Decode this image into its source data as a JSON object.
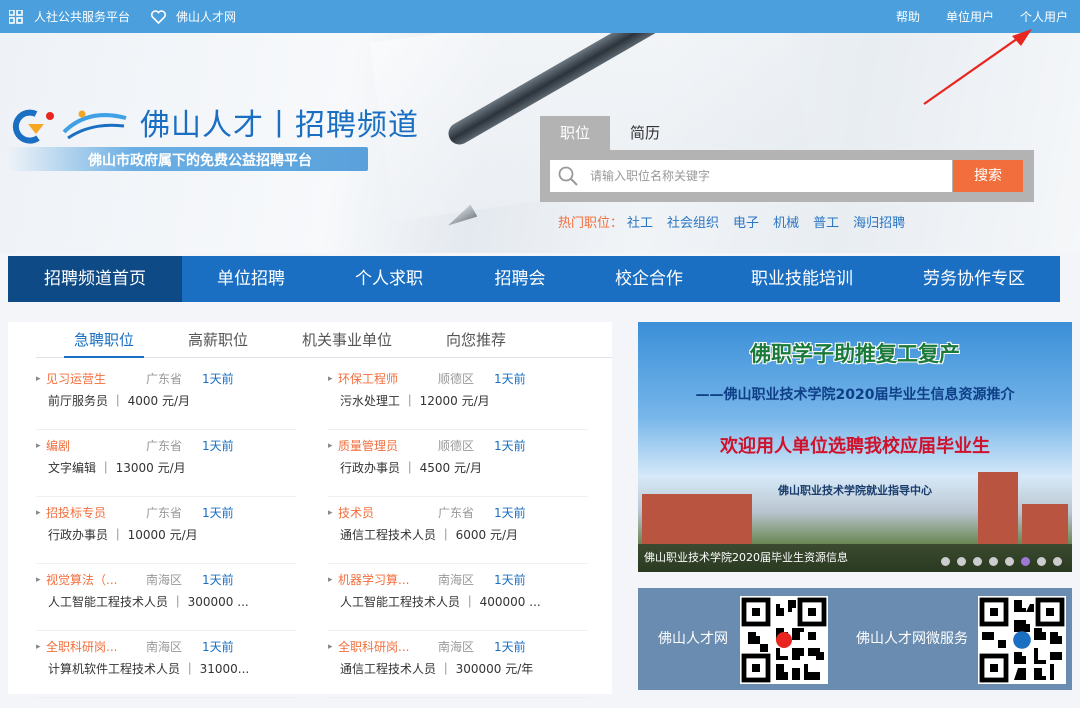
{
  "topbar": {
    "left_items": [
      "人社公共服务平台",
      "佛山人才网"
    ],
    "right_links": [
      "帮助",
      "单位用户",
      "个人用户"
    ]
  },
  "logo": {
    "title": "佛山人才丨招聘频道",
    "subtitle": "佛山市政府属下的免费公益招聘平台"
  },
  "search": {
    "tabs": [
      "职位",
      "简历"
    ],
    "active_tab": "职位",
    "placeholder": "请输入职位名称关键字",
    "button": "搜索",
    "hot_label": "热门职位：",
    "hot_keywords": [
      "社工",
      "社会组织",
      "电子",
      "机械",
      "普工",
      "海归招聘"
    ]
  },
  "nav": {
    "items": [
      "招聘频道首页",
      "单位招聘",
      "个人求职",
      "招聘会",
      "校企合作",
      "职业技能培训",
      "劳务协作专区"
    ],
    "active": "招聘频道首页"
  },
  "jobs_panel": {
    "tabs": [
      "急聘职位",
      "高薪职位",
      "机关事业单位",
      "向您推荐"
    ],
    "active_tab": "急聘职位",
    "left": [
      {
        "name": "见习运营生",
        "area": "广东省",
        "time": "1天前",
        "detail": "前厅服务员 ｜ 4000 元/月"
      },
      {
        "name": "编剧",
        "area": "广东省",
        "time": "1天前",
        "detail": "文字编辑 ｜ 13000 元/月"
      },
      {
        "name": "招投标专员",
        "area": "广东省",
        "time": "1天前",
        "detail": "行政办事员 ｜ 10000 元/月"
      },
      {
        "name": "视觉算法（...",
        "area": "南海区",
        "time": "1天前",
        "detail": "人工智能工程技术人员 ｜ 300000 ..."
      },
      {
        "name": "全职科研岗...",
        "area": "南海区",
        "time": "1天前",
        "detail": "计算机软件工程技术人员 ｜ 31000..."
      }
    ],
    "right": [
      {
        "name": "环保工程师",
        "area": "顺德区",
        "time": "1天前",
        "detail": "污水处理工 ｜ 12000 元/月"
      },
      {
        "name": "质量管理员",
        "area": "顺德区",
        "time": "1天前",
        "detail": "行政办事员 ｜ 4500 元/月"
      },
      {
        "name": "技术员",
        "area": "广东省",
        "time": "1天前",
        "detail": "通信工程技术人员 ｜ 6000 元/月"
      },
      {
        "name": "机器学习算...",
        "area": "南海区",
        "time": "1天前",
        "detail": "人工智能工程技术人员 ｜ 400000 ..."
      },
      {
        "name": "全职科研岗...",
        "area": "南海区",
        "time": "1天前",
        "detail": "通信工程技术人员 ｜ 300000 元/年"
      }
    ]
  },
  "banner": {
    "headline": "佛职学子助推复工复产",
    "subline": "——佛山职业技术学院2020届毕业生信息资源推介",
    "welcome": "欢迎用人单位选聘我校应届毕业生",
    "org": "佛山职业技术学院就业指导中心",
    "caption": "佛山职业技术学院2020届毕业生资源信息",
    "slide_count": 8,
    "active_slide": 5
  },
  "qr": {
    "left_label": "佛山人才网",
    "right_label": "佛山人才网微服务"
  },
  "colors": {
    "topbar": "#4a9fdc",
    "nav": "#1a6fc2",
    "nav_active": "#0d4a86",
    "accent": "#f26f3d",
    "arrow": "#e8261f"
  }
}
